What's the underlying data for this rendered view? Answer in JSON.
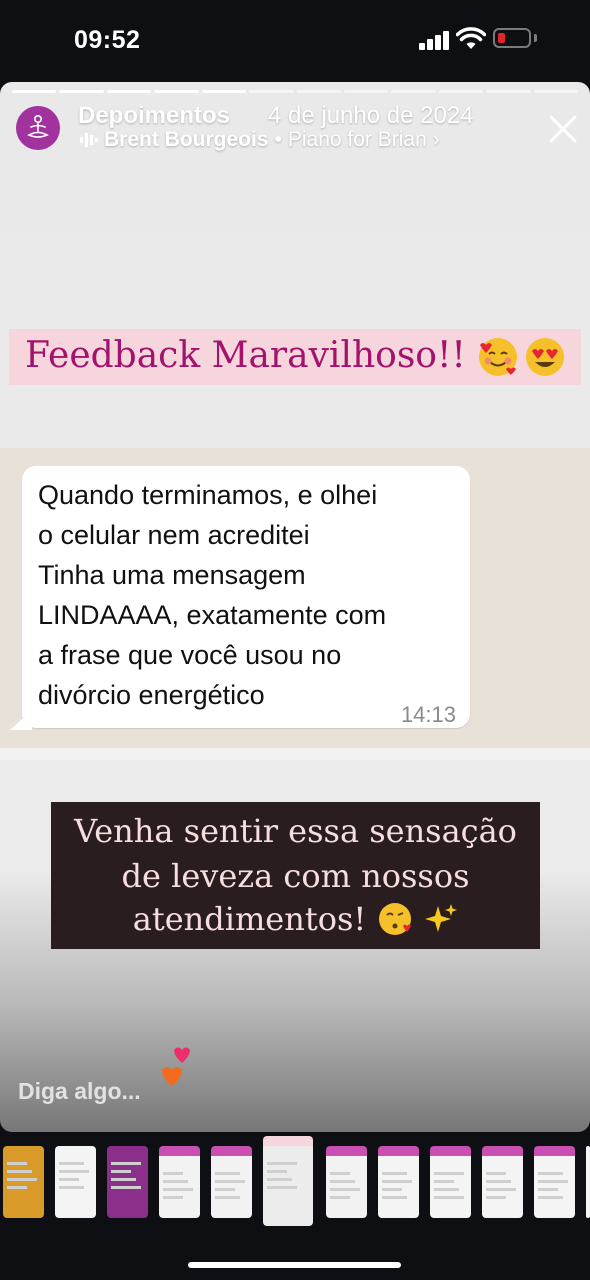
{
  "status_bar": {
    "time": "09:52",
    "battery_level": "low",
    "battery_color": "#e0262a"
  },
  "story": {
    "progress_segments_total": 12,
    "progress_segments_done": 5,
    "account_name": "Depoimentos",
    "date": "4 de junho de 2024",
    "music": {
      "artist": "Brent Bourgeois",
      "separator": "•",
      "song": "Piano for Brian",
      "chevron": "›"
    },
    "feedback_title": "Feedback Maravilhoso!!",
    "message": {
      "lines": [
        "Quando terminamos, e olhei",
        "o celular nem acreditei",
        "Tinha uma mensagem",
        "LINDAAAA, exatamente com",
        "a frase que você usou no",
        "divórcio energético"
      ],
      "time": "14:13"
    },
    "cta_lines": [
      "Venha sentir essa sensação",
      "de leveza com nossos",
      "atendimentos!"
    ],
    "reply_placeholder": "Diga algo..."
  },
  "icons": {
    "avatar": "meditation-icon",
    "close": "close-icon",
    "music": "music-bars-icon",
    "emojis": [
      "smiling-face-with-hearts-emoji",
      "heart-eyes-emoji",
      "kissing-heart-emoji",
      "sparkles-emoji"
    ],
    "reaction": "heart-reaction-icon"
  },
  "colors": {
    "brand_purple": "#a2339e",
    "feedback_text": "#a3126c",
    "feedback_bg": "#f6d6dc",
    "cta_bg": "#2a1d1f",
    "cta_text": "#f6dede"
  },
  "thumbnails_count": 12
}
